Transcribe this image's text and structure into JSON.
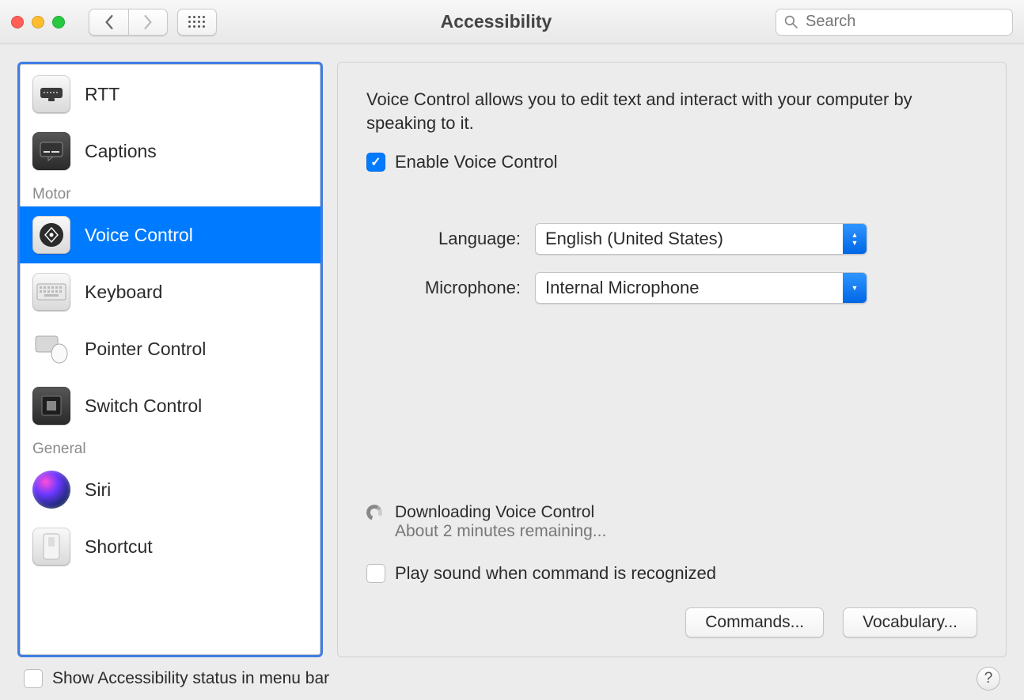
{
  "titlebar": {
    "title": "Accessibility",
    "search_placeholder": "Search"
  },
  "sidebar": {
    "items": [
      {
        "label": "RTT",
        "icon": "rtt-icon",
        "selected": false
      },
      {
        "label": "Captions",
        "icon": "captions-icon",
        "selected": false
      }
    ],
    "motor_label": "Motor",
    "motor_items": [
      {
        "label": "Voice Control",
        "icon": "voice-control-icon",
        "selected": true
      },
      {
        "label": "Keyboard",
        "icon": "keyboard-icon",
        "selected": false
      },
      {
        "label": "Pointer Control",
        "icon": "pointer-icon",
        "selected": false
      },
      {
        "label": "Switch Control",
        "icon": "switch-icon",
        "selected": false
      }
    ],
    "general_label": "General",
    "general_items": [
      {
        "label": "Siri",
        "icon": "siri-icon",
        "selected": false
      },
      {
        "label": "Shortcut",
        "icon": "shortcut-icon",
        "selected": false
      }
    ]
  },
  "panel": {
    "intro": "Voice Control allows you to edit text and interact with your computer by speaking to it.",
    "enable_label": "Enable Voice Control",
    "enable_checked": true,
    "language_label": "Language:",
    "language_value": "English (United States)",
    "microphone_label": "Microphone:",
    "microphone_value": "Internal Microphone",
    "download_title": "Downloading Voice Control",
    "download_eta": "About 2 minutes remaining...",
    "play_sound_label": "Play sound when command is recognized",
    "play_sound_checked": false,
    "commands_btn": "Commands...",
    "vocabulary_btn": "Vocabulary..."
  },
  "footer": {
    "status_label": "Show Accessibility status in menu bar",
    "status_checked": false
  }
}
